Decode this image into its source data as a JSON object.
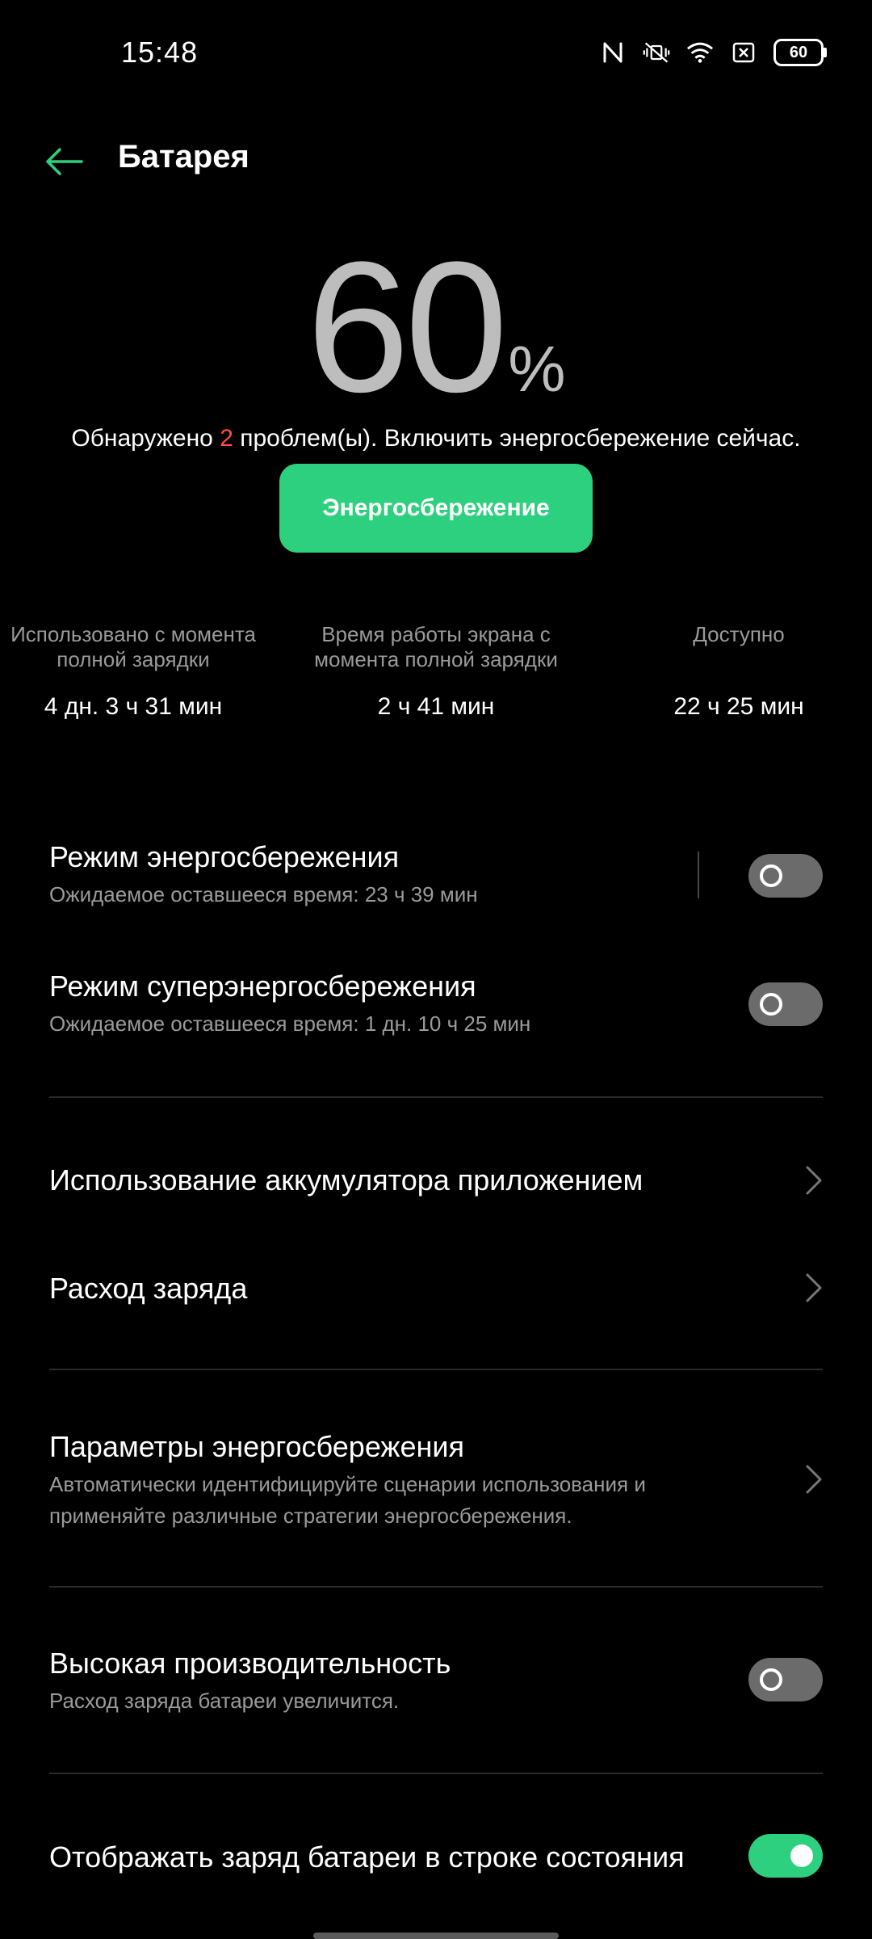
{
  "status_bar": {
    "time": "15:48",
    "battery": "60",
    "icons": [
      "nfc-icon",
      "mute-vibrate-icon",
      "wifi-icon",
      "sim-icon",
      "battery-icon"
    ]
  },
  "header": {
    "title": "Батарея"
  },
  "battery": {
    "percent": "60",
    "percent_sign": "%",
    "issues_prefix": "Обнаружено ",
    "issues_count": "2",
    "issues_suffix": " проблем(ы). Включить энергосбережение сейчас.",
    "saver_button": "Энергосбережение"
  },
  "stats": [
    {
      "label": "Использовано с момента полной зарядки",
      "value": "4 дн. 3 ч 31 мин"
    },
    {
      "label": "Время работы экрана с момента полной зарядки",
      "value": "2 ч 41 мин"
    },
    {
      "label": "Доступно",
      "value": "22 ч 25 мин"
    }
  ],
  "settings": {
    "power_saving": {
      "title": "Режим энергосбережения",
      "subtitle": "Ожидаемое оставшееся время:  23 ч 39 мин",
      "enabled": false
    },
    "super_power_saving": {
      "title": "Режим суперэнергосбережения",
      "subtitle": "Ожидаемое оставшееся время:  1 дн. 10 ч 25 мин",
      "enabled": false
    },
    "app_battery_usage": {
      "title": "Использование аккумулятора приложением"
    },
    "charge_consumption": {
      "title": "Расход заряда"
    },
    "power_saving_params": {
      "title": "Параметры энергосбережения",
      "subtitle": "Автоматически идентифицируйте сценарии использования и применяйте различные стратегии энергосбережения."
    },
    "high_performance": {
      "title": "Высокая производительность",
      "subtitle": "Расход заряда батареи увеличится.",
      "enabled": false
    },
    "show_battery_in_status_bar": {
      "title": "Отображать заряд батареи в строке состояния",
      "enabled": true
    }
  },
  "colors": {
    "accent": "#2dd07e",
    "warning": "#ff4b4b",
    "background": "#000000"
  }
}
